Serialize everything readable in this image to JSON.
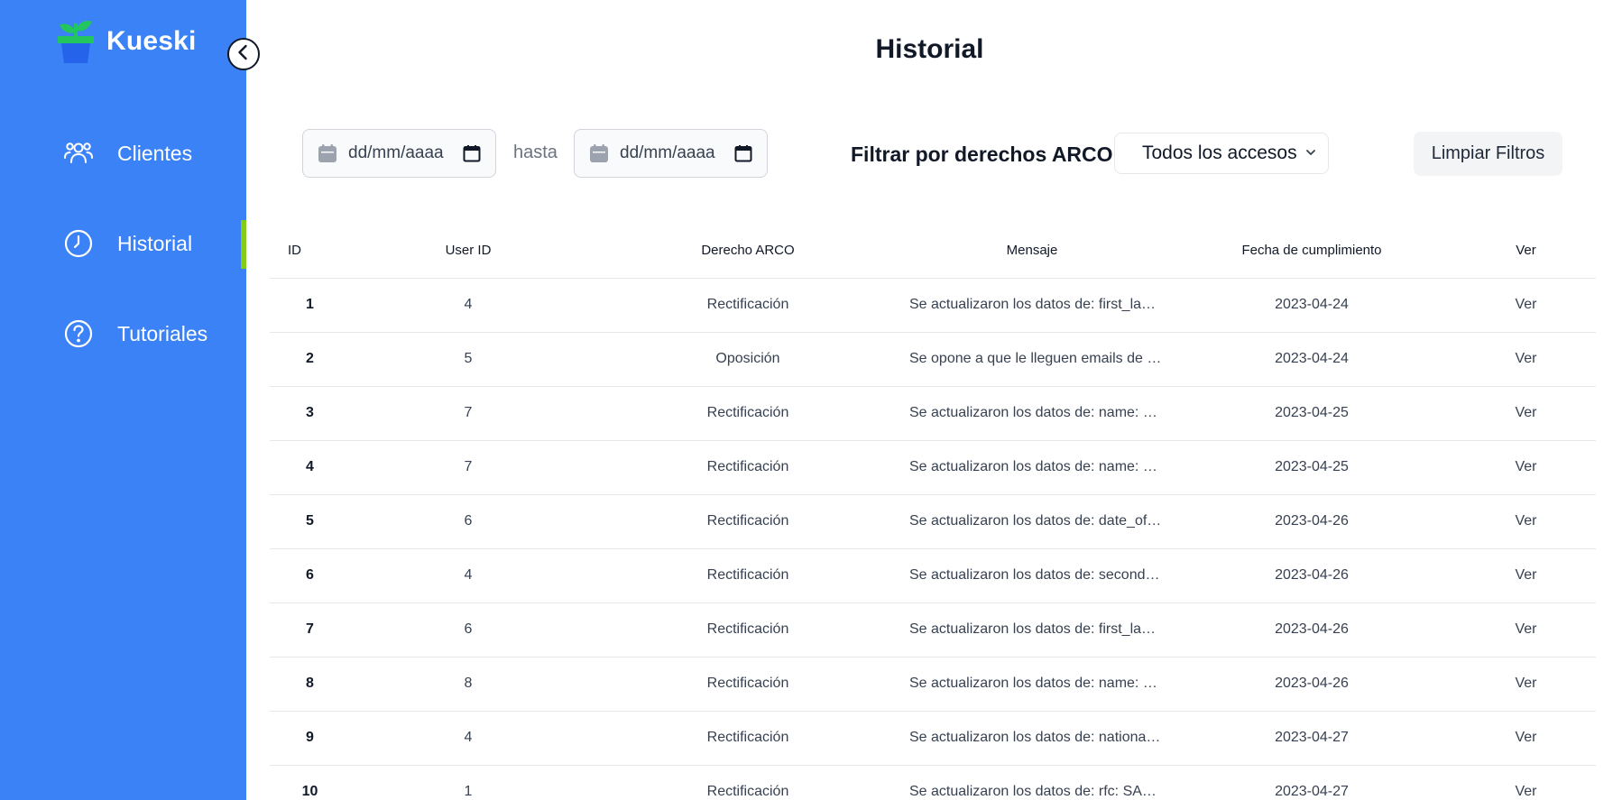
{
  "brand": {
    "name": "Kueski"
  },
  "colors": {
    "sidebar": "#3b82f6",
    "active_indicator": "#84cc16",
    "logo_leaf": "#22c55e",
    "logo_pot": "#2563eb"
  },
  "sidebar": {
    "items": [
      {
        "label": "Clientes",
        "icon": "users-icon",
        "active": false
      },
      {
        "label": "Historial",
        "icon": "clock-icon",
        "active": true
      },
      {
        "label": "Tutoriales",
        "icon": "help-circle-icon",
        "active": false
      }
    ]
  },
  "page": {
    "title": "Historial"
  },
  "filters": {
    "date_from_placeholder": "dd/mm/aaaa",
    "separator": "hasta",
    "date_to_placeholder": "dd/mm/aaaa",
    "arco_label": "Filtrar por derechos ARCO:",
    "arco_selected": "Todos los accesos",
    "clear_label": "Limpiar Filtros"
  },
  "table": {
    "headers": [
      "ID",
      "User ID",
      "Derecho ARCO",
      "Mensaje",
      "Fecha de cumplimiento",
      "Ver"
    ],
    "rows": [
      {
        "id": "1",
        "user_id": "4",
        "derecho": "Rectificación",
        "mensaje": "Se actualizaron los datos de: first_last_name",
        "fecha": "2023-04-24",
        "ver": "Ver"
      },
      {
        "id": "2",
        "user_id": "5",
        "derecho": "Oposición",
        "mensaje": "Se opone a que le lleguen emails de publicidad",
        "fecha": "2023-04-24",
        "ver": "Ver"
      },
      {
        "id": "3",
        "user_id": "7",
        "derecho": "Rectificación",
        "mensaje": "Se actualizaron los datos de: name: Pedro",
        "fecha": "2023-04-25",
        "ver": "Ver"
      },
      {
        "id": "4",
        "user_id": "7",
        "derecho": "Rectificación",
        "mensaje": "Se actualizaron los datos de: name: Pablo",
        "fecha": "2023-04-25",
        "ver": "Ver"
      },
      {
        "id": "5",
        "user_id": "6",
        "derecho": "Rectificación",
        "mensaje": "Se actualizaron los datos de: date_of_birth",
        "fecha": "2023-04-26",
        "ver": "Ver"
      },
      {
        "id": "6",
        "user_id": "4",
        "derecho": "Rectificación",
        "mensaje": "Se actualizaron los datos de: second_last_name",
        "fecha": "2023-04-26",
        "ver": "Ver"
      },
      {
        "id": "7",
        "user_id": "6",
        "derecho": "Rectificación",
        "mensaje": "Se actualizaron los datos de: first_last_name",
        "fecha": "2023-04-26",
        "ver": "Ver"
      },
      {
        "id": "8",
        "user_id": "8",
        "derecho": "Rectificación",
        "mensaje": "Se actualizaron los datos de: name: Luis",
        "fecha": "2023-04-26",
        "ver": "Ver"
      },
      {
        "id": "9",
        "user_id": "4",
        "derecho": "Rectificación",
        "mensaje": "Se actualizaron los datos de: nationality",
        "fecha": "2023-04-27",
        "ver": "Ver"
      },
      {
        "id": "10",
        "user_id": "1",
        "derecho": "Rectificación",
        "mensaje": "Se actualizaron los datos de: rfc: SAGA",
        "fecha": "2023-04-27",
        "ver": "Ver"
      }
    ]
  }
}
